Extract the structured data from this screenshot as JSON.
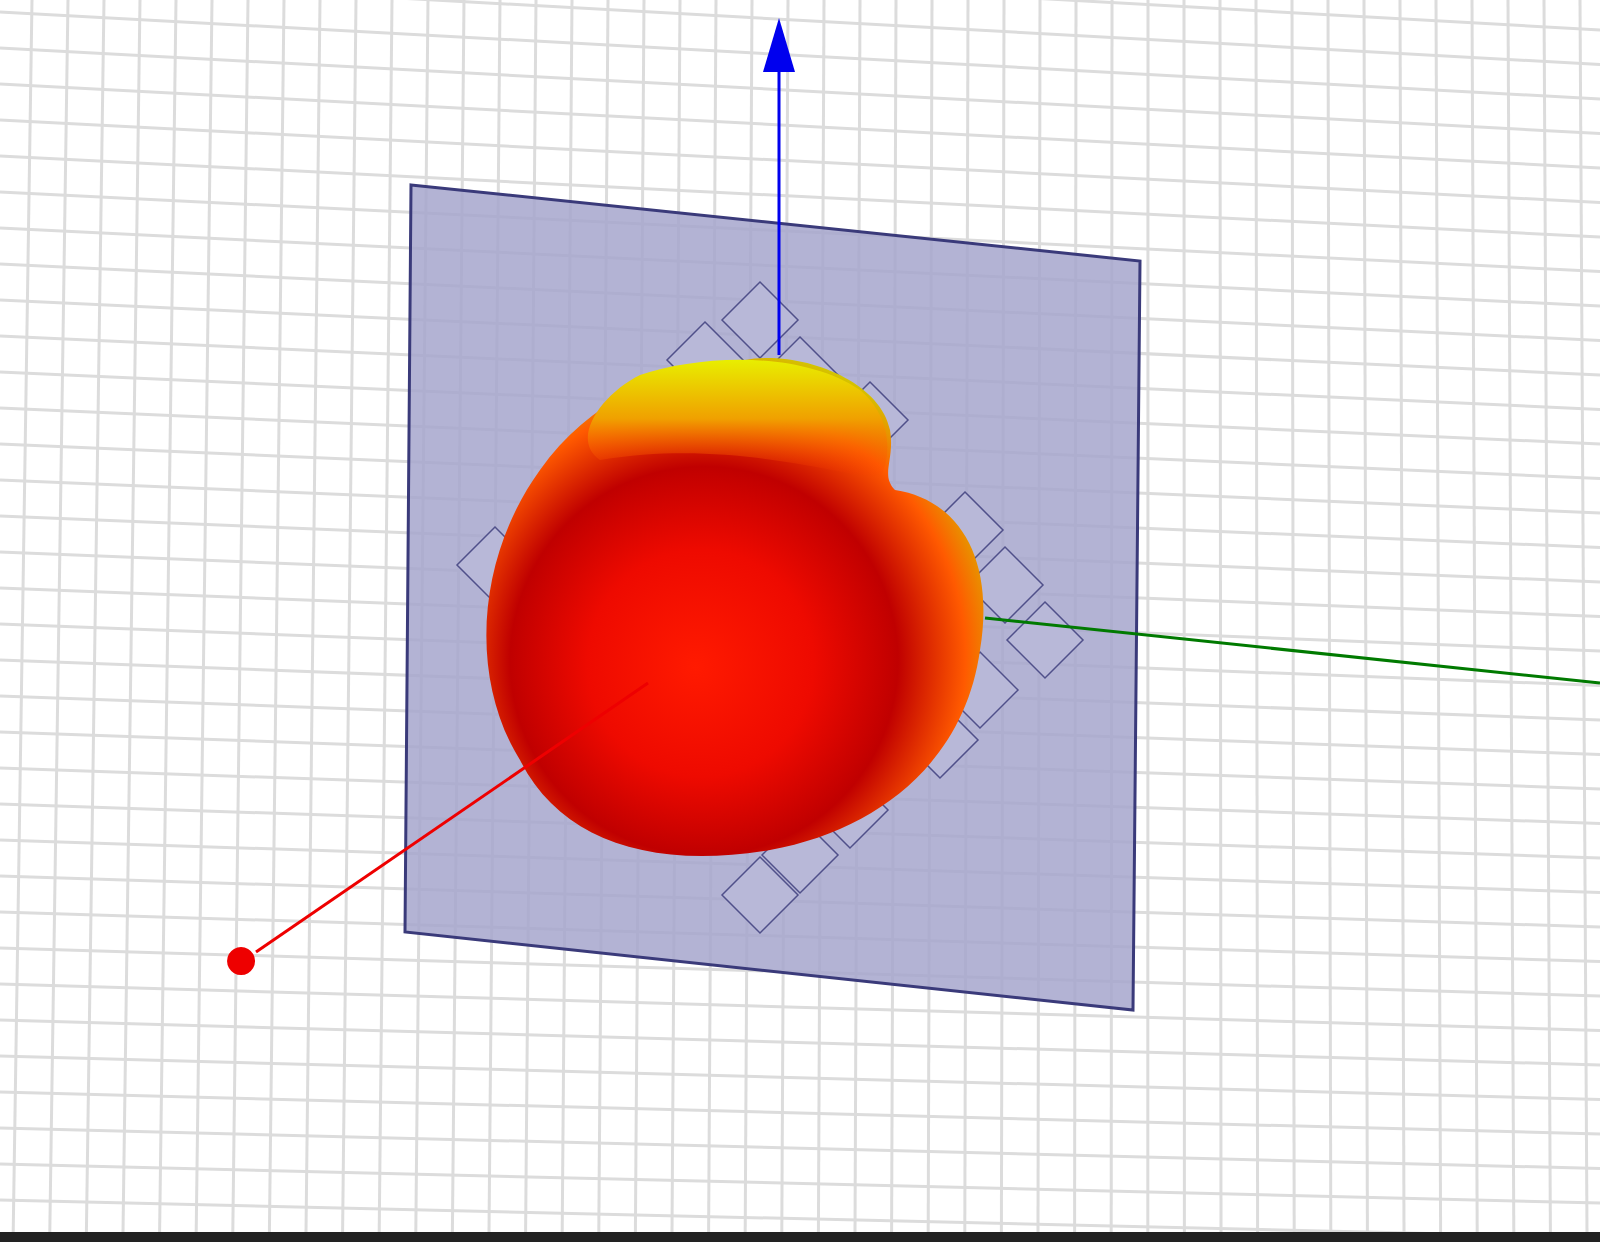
{
  "viewport": {
    "axes": [
      {
        "kind": "up",
        "color": "#0000ee"
      },
      {
        "kind": "right",
        "color": "#007a00"
      },
      {
        "kind": "toward",
        "color": "#ee0000"
      }
    ]
  }
}
